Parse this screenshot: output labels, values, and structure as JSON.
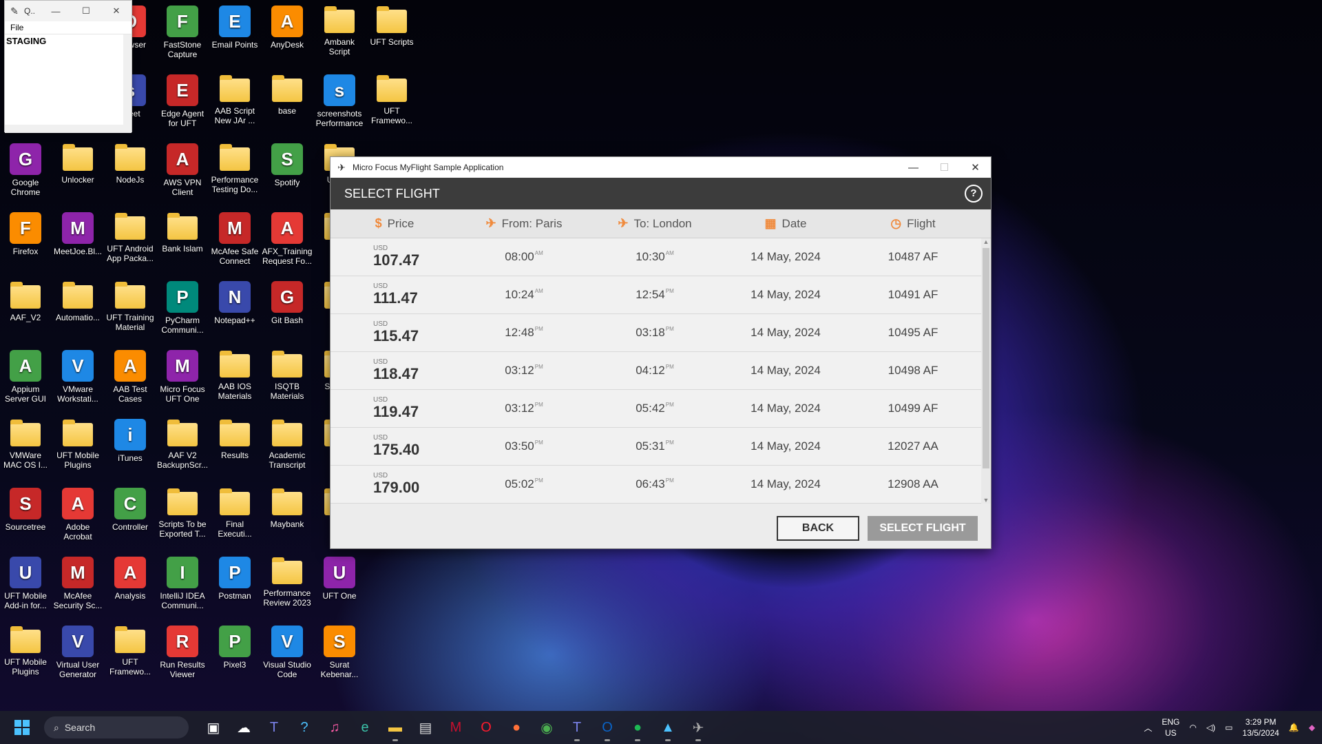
{
  "notepad": {
    "title": "Q..",
    "menu_file": "File",
    "content": "STAGING"
  },
  "desktop_icons": [
    {
      "label": "Opera Browser",
      "display": "era\nwser"
    },
    {
      "label": "FastStone Capture"
    },
    {
      "label": "Email Points"
    },
    {
      "label": "AnyDesk"
    },
    {
      "label": "Ambank Script"
    },
    {
      "label": "UFT Scripts"
    },
    {
      "label": "sheet"
    },
    {
      "label": "Edge Agent for UFT"
    },
    {
      "label": "AAB Script New JAr ..."
    },
    {
      "label": "base"
    },
    {
      "label": "screenshots Performance"
    },
    {
      "label": "UFT Framewo..."
    },
    {
      "label": "Google Chrome"
    },
    {
      "label": "Unlocker"
    },
    {
      "label": "NodeJs"
    },
    {
      "label": "AWS VPN Client"
    },
    {
      "label": "Performance Testing Do..."
    },
    {
      "label": "Spotify"
    },
    {
      "label": "UFT In"
    },
    {
      "label": "Firefox"
    },
    {
      "label": "MeetJoe.Bl..."
    },
    {
      "label": "UFT Android App Packa..."
    },
    {
      "label": "Bank Islam"
    },
    {
      "label": "McAfee Safe Connect"
    },
    {
      "label": "AFX_Training Request Fo..."
    },
    {
      "label": "S"
    },
    {
      "label": "AAF_V2"
    },
    {
      "label": "Automatio..."
    },
    {
      "label": "UFT Training Material"
    },
    {
      "label": "PyCharm Communi..."
    },
    {
      "label": "Notepad++"
    },
    {
      "label": "Git Bash"
    },
    {
      "label": "Te"
    },
    {
      "label": "Appium Server GUI"
    },
    {
      "label": "VMware Workstati..."
    },
    {
      "label": "AAB Test Cases"
    },
    {
      "label": "Micro Focus UFT One"
    },
    {
      "label": "AAB IOS Materials"
    },
    {
      "label": "ISQTB Materials"
    },
    {
      "label": "Se Java"
    },
    {
      "label": "VMWare MAC OS I..."
    },
    {
      "label": "UFT Mobile Plugins"
    },
    {
      "label": "iTunes"
    },
    {
      "label": "AAF V2 BackupnScr..."
    },
    {
      "label": "Results"
    },
    {
      "label": "Academic Transcript"
    },
    {
      "label": "Te"
    },
    {
      "label": "Sourcetree"
    },
    {
      "label": "Adobe Acrobat"
    },
    {
      "label": "Controller"
    },
    {
      "label": "Scripts To be Exported T..."
    },
    {
      "label": "Final Executi..."
    },
    {
      "label": "Maybank"
    },
    {
      "label": "Scr"
    },
    {
      "label": "UFT Mobile Add-in for..."
    },
    {
      "label": "McAfee Security Sc..."
    },
    {
      "label": "Analysis"
    },
    {
      "label": "IntelliJ IDEA Communi..."
    },
    {
      "label": "Postman"
    },
    {
      "label": "Performance Review 2023"
    },
    {
      "label": "UFT One"
    },
    {
      "label": "UFT Mobile Plugins"
    },
    {
      "label": "Virtual User Generator"
    },
    {
      "label": "UFT Framewo..."
    },
    {
      "label": "Run Results Viewer"
    },
    {
      "label": "Pixel3"
    },
    {
      "label": "Visual Studio Code"
    },
    {
      "label": "Surat Kebenar..."
    }
  ],
  "app": {
    "window_title": "Micro Focus MyFlight Sample Application",
    "header": "SELECT FLIGHT",
    "help": "?",
    "columns": {
      "price": "Price",
      "from": "From: Paris",
      "to": "To: London",
      "date": "Date",
      "flight": "Flight"
    },
    "flights": [
      {
        "currency": "USD",
        "price": "107.47",
        "dep": "08:00",
        "dep_ampm": "AM",
        "arr": "10:30",
        "arr_ampm": "AM",
        "date": "14 May, 2024",
        "flight": "10487 AF"
      },
      {
        "currency": "USD",
        "price": "111.47",
        "dep": "10:24",
        "dep_ampm": "AM",
        "arr": "12:54",
        "arr_ampm": "PM",
        "date": "14 May, 2024",
        "flight": "10491 AF"
      },
      {
        "currency": "USD",
        "price": "115.47",
        "dep": "12:48",
        "dep_ampm": "PM",
        "arr": "03:18",
        "arr_ampm": "PM",
        "date": "14 May, 2024",
        "flight": "10495 AF"
      },
      {
        "currency": "USD",
        "price": "118.47",
        "dep": "03:12",
        "dep_ampm": "PM",
        "arr": "04:12",
        "arr_ampm": "PM",
        "date": "14 May, 2024",
        "flight": "10498 AF"
      },
      {
        "currency": "USD",
        "price": "119.47",
        "dep": "03:12",
        "dep_ampm": "PM",
        "arr": "05:42",
        "arr_ampm": "PM",
        "date": "14 May, 2024",
        "flight": "10499 AF"
      },
      {
        "currency": "USD",
        "price": "175.40",
        "dep": "03:50",
        "dep_ampm": "PM",
        "arr": "05:31",
        "arr_ampm": "PM",
        "date": "14 May, 2024",
        "flight": "12027 AA"
      },
      {
        "currency": "USD",
        "price": "179.00",
        "dep": "05:02",
        "dep_ampm": "PM",
        "arr": "06:43",
        "arr_ampm": "PM",
        "date": "14 May, 2024",
        "flight": "12908 AA"
      }
    ],
    "back_label": "BACK",
    "select_label": "SELECT FLIGHT",
    "accent_color": "#f08a3c"
  },
  "taskbar": {
    "search_placeholder": "Search",
    "lang_top": "ENG",
    "lang_bottom": "US",
    "time": "3:29 PM",
    "date": "13/5/2024"
  }
}
